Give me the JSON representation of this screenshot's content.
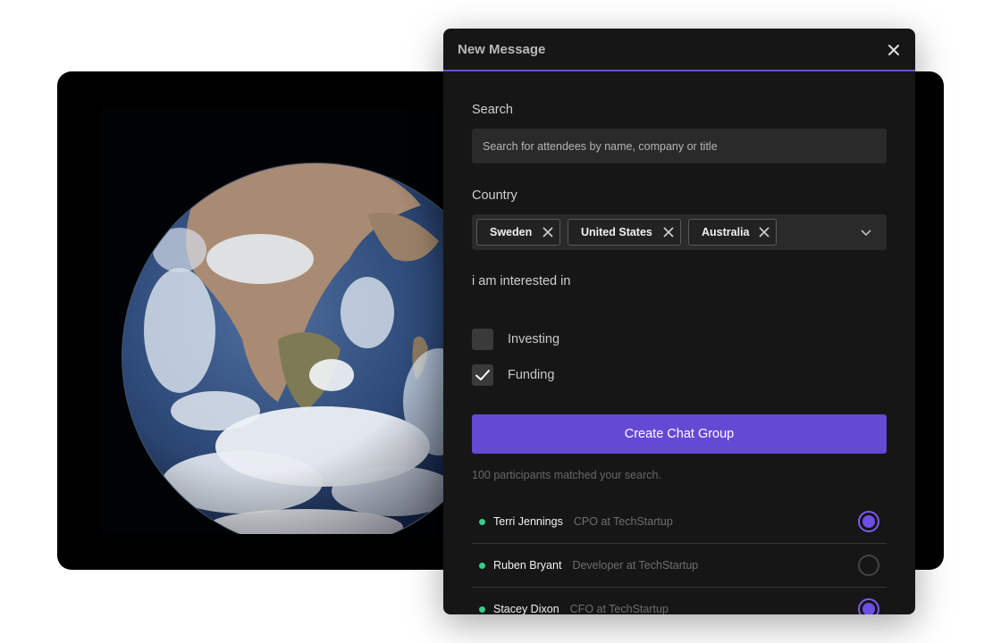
{
  "modal": {
    "title": "New Message",
    "search_label": "Search",
    "search_placeholder": "Search for attendees by name, company or title",
    "country_label": "Country",
    "countries": [
      "Sweden",
      "United States",
      "Australia"
    ],
    "interest_label": "i am interested in",
    "interests": [
      {
        "label": "Investing",
        "checked": false
      },
      {
        "label": "Funding",
        "checked": true
      }
    ],
    "create_button": "Create Chat Group",
    "matched_text": "100 participants matched your search.",
    "participants": [
      {
        "name": "Terri Jennings",
        "role": "CPO at TechStartup",
        "selected": true
      },
      {
        "name": "Ruben Bryant",
        "role": "Developer at TechStartup",
        "selected": false
      },
      {
        "name": "Stacey Dixon",
        "role": "CFO at TechStartup",
        "selected": true
      }
    ]
  },
  "colors": {
    "accent": "#6449d3",
    "online": "#35cf88",
    "modal_bg": "#161616"
  },
  "icons": [
    "close-icon",
    "chip-remove-icon",
    "chevron-down-icon",
    "checkmark-icon"
  ]
}
